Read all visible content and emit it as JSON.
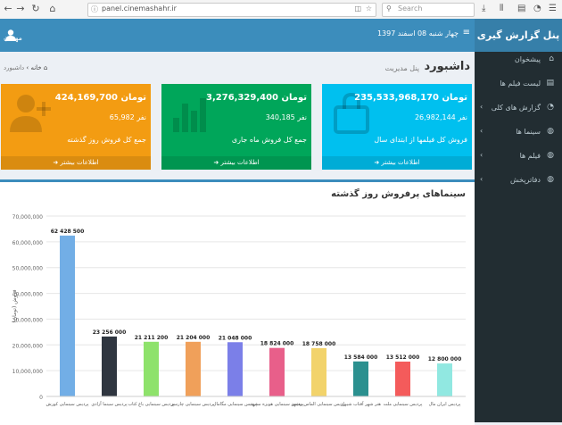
{
  "browser": {
    "url": "panel.cinemashahr.ir",
    "search_placeholder": "Search"
  },
  "topbar": {
    "date": "چهار شنبه 08 اسفند 1397",
    "user": "مهمان",
    "menu_icon": "hamburger-icon",
    "user_icon": "user-icon"
  },
  "sidebar": {
    "title": "پنل گزارش گیری",
    "items": [
      {
        "label": "پیشخوان",
        "icon": "home-icon",
        "has_arrow": false
      },
      {
        "label": "لیست فیلم ها",
        "icon": "list-icon",
        "has_arrow": false
      },
      {
        "label": "گزارش های کلی",
        "icon": "chart-icon",
        "has_arrow": true
      },
      {
        "label": "سینما ها",
        "icon": "film-icon",
        "has_arrow": true
      },
      {
        "label": "فیلم ها",
        "icon": "film-icon",
        "has_arrow": true
      },
      {
        "label": "دفاترپخش",
        "icon": "film-icon",
        "has_arrow": true
      }
    ]
  },
  "content_header": {
    "title": "داشبورد",
    "subtitle": "پنل مدیریت",
    "breadcrumb_home": "خانه",
    "breadcrumb_current": "داشبورد",
    "breadcrumb_sep": "›"
  },
  "boxes": [
    {
      "amount": "235,533,968,170 تومان",
      "count": "26,982,144 نفر",
      "label": "فروش کل فیلمها از ابتدای سال",
      "more": "اطلاعات بیشتر",
      "color": "#00c0ef",
      "icon": "shopping-bag-icon"
    },
    {
      "amount": "3,276,329,400 تومان",
      "count": "340,185 نفر",
      "label": "جمع کل فروش ماه جاری",
      "more": "اطلاعات بیشتر",
      "color": "#00a65a",
      "icon": "bar-chart-icon"
    },
    {
      "amount": "424,169,700 تومان",
      "count": "65,982 نفر",
      "label": "جمع کل فروش روز گذشته",
      "more": "اطلاعات بیشتر",
      "color": "#f39c12",
      "icon": "user-plus-icon"
    }
  ],
  "chart_section": {
    "title": "سینماهای پرفروش روز گذشته"
  },
  "chart_data": {
    "type": "bar",
    "ylabel": "فروش (تومان)",
    "ylim": [
      0,
      70000000
    ],
    "yticks": [
      "0",
      "10,000,000",
      "20,000,000",
      "30,000,000",
      "40,000,000",
      "50,000,000",
      "60,000,000",
      "70,000,000"
    ],
    "grid": true,
    "categories": [
      "پردیس سینمایی کورش",
      "پردیس سینما آزادی",
      "پردیس سینمایی باغ کتاب",
      "پردیس سینمایی چارسو",
      "پردیس سینمایی مگامال",
      "پردیس سینمایی هویزه مشهد",
      "پردیس سینمایی الماس مشهد",
      "هنر شهر آفتاب شیراز",
      "پردیس سینمایی ملت",
      "پردیس ایران مال"
    ],
    "values": [
      62428500,
      23256000,
      21211200,
      21204000,
      21048000,
      18824000,
      18758000,
      13584000,
      13512000,
      12800000
    ],
    "value_labels": [
      "62 428 500",
      "23 256 000",
      "21 211 200",
      "21 204 000",
      "21 048 000",
      "18 824 000",
      "18 758 000",
      "13 584 000",
      "13 512 000",
      "12 800 000"
    ],
    "colors": [
      "#72aee6",
      "#2f3640",
      "#8ee26b",
      "#f0a05a",
      "#7b7fe8",
      "#e85f8a",
      "#f2d36b",
      "#2b908f",
      "#f45b5b",
      "#91e8e1"
    ]
  }
}
